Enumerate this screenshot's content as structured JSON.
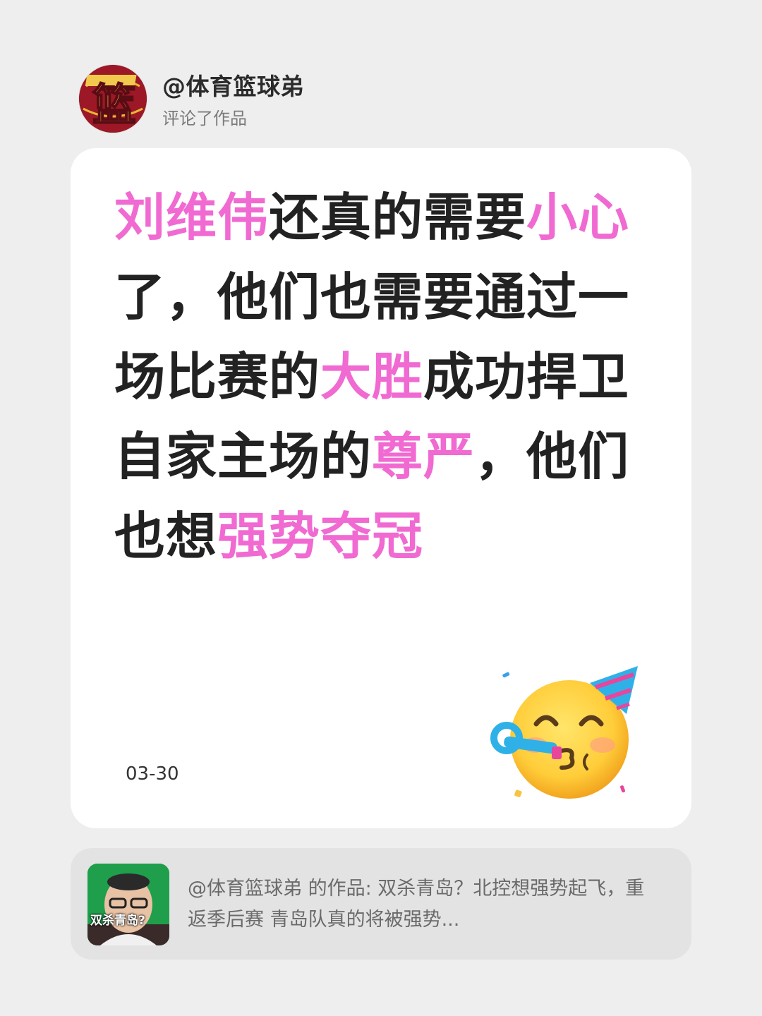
{
  "header": {
    "username": "@体育篮球弟",
    "action": "评论了作品",
    "avatar_text": "篮",
    "avatar_icon": "basketball-logo-avatar"
  },
  "comment": {
    "segments": [
      {
        "text": "刘维伟",
        "highlight": true
      },
      {
        "text": "还真的需要",
        "highlight": false
      },
      {
        "text": "小心",
        "highlight": true
      },
      {
        "text": "了，他们也需要通过一场比赛的",
        "highlight": false
      },
      {
        "text": "大胜",
        "highlight": true
      },
      {
        "text": "成功捍卫自家主场的",
        "highlight": false
      },
      {
        "text": "尊严",
        "highlight": true
      },
      {
        "text": "，他们也想",
        "highlight": false
      },
      {
        "text": "强势夺冠",
        "highlight": true
      }
    ],
    "date": "03-30",
    "emoji": "party-face-emoji"
  },
  "reference": {
    "text": "@体育篮球弟  的作品: 双杀青岛？北控想强势起飞，重返季后赛 青岛队真的将被强势...",
    "thumbnail_caption": "双杀青岛?",
    "thumbnail_icon": "video-thumbnail"
  },
  "colors": {
    "background": "#eeeeee",
    "highlight": "#f06ad2",
    "text": "#222222",
    "card": "#ffffff",
    "ref_card": "#e3e3e3"
  }
}
